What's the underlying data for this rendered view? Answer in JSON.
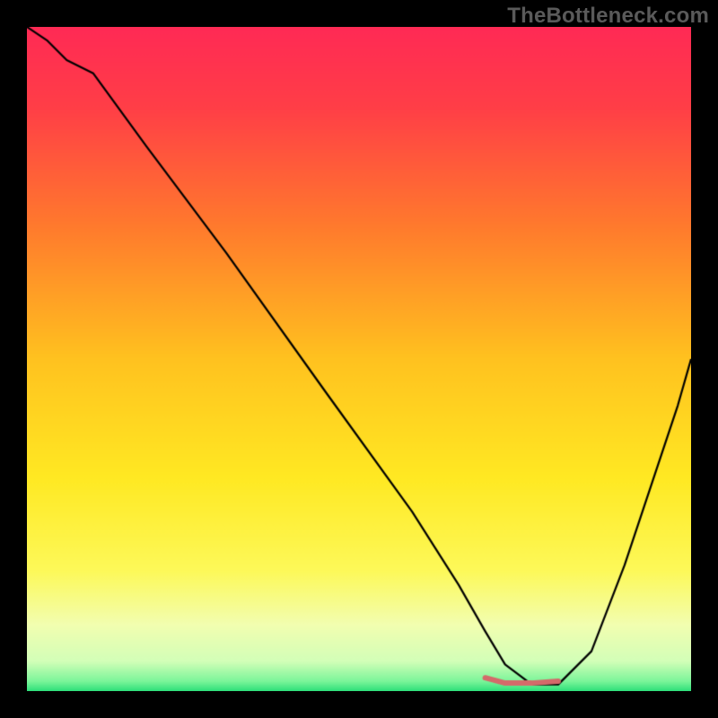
{
  "watermark": "TheBottleneck.com",
  "chart_data": {
    "type": "line",
    "title": "",
    "xlabel": "",
    "ylabel": "",
    "xlim": [
      0,
      100
    ],
    "ylim": [
      0,
      100
    ],
    "grid": false,
    "gradient_stops": [
      {
        "t": 0.0,
        "color": "#ff2a55"
      },
      {
        "t": 0.12,
        "color": "#ff3e47"
      },
      {
        "t": 0.3,
        "color": "#ff7a2d"
      },
      {
        "t": 0.5,
        "color": "#ffc21f"
      },
      {
        "t": 0.68,
        "color": "#ffe923"
      },
      {
        "t": 0.82,
        "color": "#fdf95a"
      },
      {
        "t": 0.9,
        "color": "#f2feb0"
      },
      {
        "t": 0.955,
        "color": "#d3ffb8"
      },
      {
        "t": 0.985,
        "color": "#7cf59a"
      },
      {
        "t": 1.0,
        "color": "#2de07a"
      }
    ],
    "series": [
      {
        "name": "bottleneck-curve",
        "color": "#000000",
        "width": 2.2,
        "x": [
          0,
          3,
          6,
          10,
          18,
          30,
          45,
          58,
          65,
          69,
          72,
          76,
          80,
          85,
          90,
          94,
          98,
          100
        ],
        "values": [
          100,
          98,
          95,
          93,
          82,
          66,
          45,
          27,
          16,
          9,
          4,
          1,
          1,
          6,
          19,
          31,
          43,
          50
        ]
      },
      {
        "name": "highlight-flat",
        "color": "#d46a6a",
        "width": 6,
        "cap": "round",
        "x": [
          69,
          72,
          76,
          80
        ],
        "values": [
          2,
          1.2,
          1.2,
          1.5
        ]
      }
    ]
  }
}
